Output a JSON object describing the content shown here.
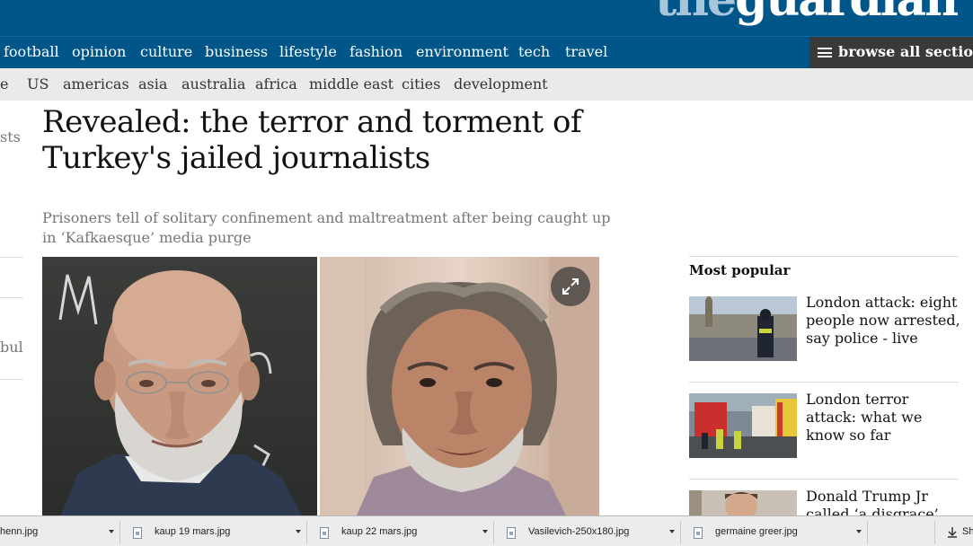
{
  "masthead": {
    "logo_the": "the",
    "logo_guardian": "guardian"
  },
  "nav_primary": {
    "items": [
      "football",
      "opinion",
      "culture",
      "business",
      "lifestyle",
      "fashion",
      "environment",
      "tech",
      "travel"
    ],
    "browse_label": "browse all sections"
  },
  "nav_secondary": {
    "items": [
      "e",
      "US",
      "americas",
      "asia",
      "australia",
      "africa",
      "middle east",
      "cities",
      "development"
    ]
  },
  "left_strip": {
    "frag1": "sts",
    "frag2": "bul"
  },
  "article": {
    "headline_line1": "Revealed: the terror and torment of",
    "headline_line2": "Turkey's jailed journalists",
    "standfirst": "Prisoners tell of solitary confinement and maltreatment after being caught up in ‘Kafkaesque’ media purge",
    "expand_icon": "expand-icon"
  },
  "most_popular": {
    "title": "Most popular",
    "items": [
      {
        "title": "London attack: eight people now arrested, say police - live"
      },
      {
        "title": "London terror attack: what we know so far"
      },
      {
        "title": "Donald Trump Jr called ‘a disgrace’ for tweet"
      }
    ]
  },
  "downloads": {
    "items": [
      {
        "name": "henn.jpg"
      },
      {
        "name": "kaup 19 mars.jpg"
      },
      {
        "name": "kaup 22 mars.jpg"
      },
      {
        "name": "Vasilevich-250x180.jpg"
      },
      {
        "name": "germaine greer.jpg"
      }
    ],
    "show_all": "Sh"
  },
  "colors": {
    "brand_blue": "#005689",
    "browse_bg": "#3a3a3a",
    "subnav_bg": "#eaeaea"
  }
}
